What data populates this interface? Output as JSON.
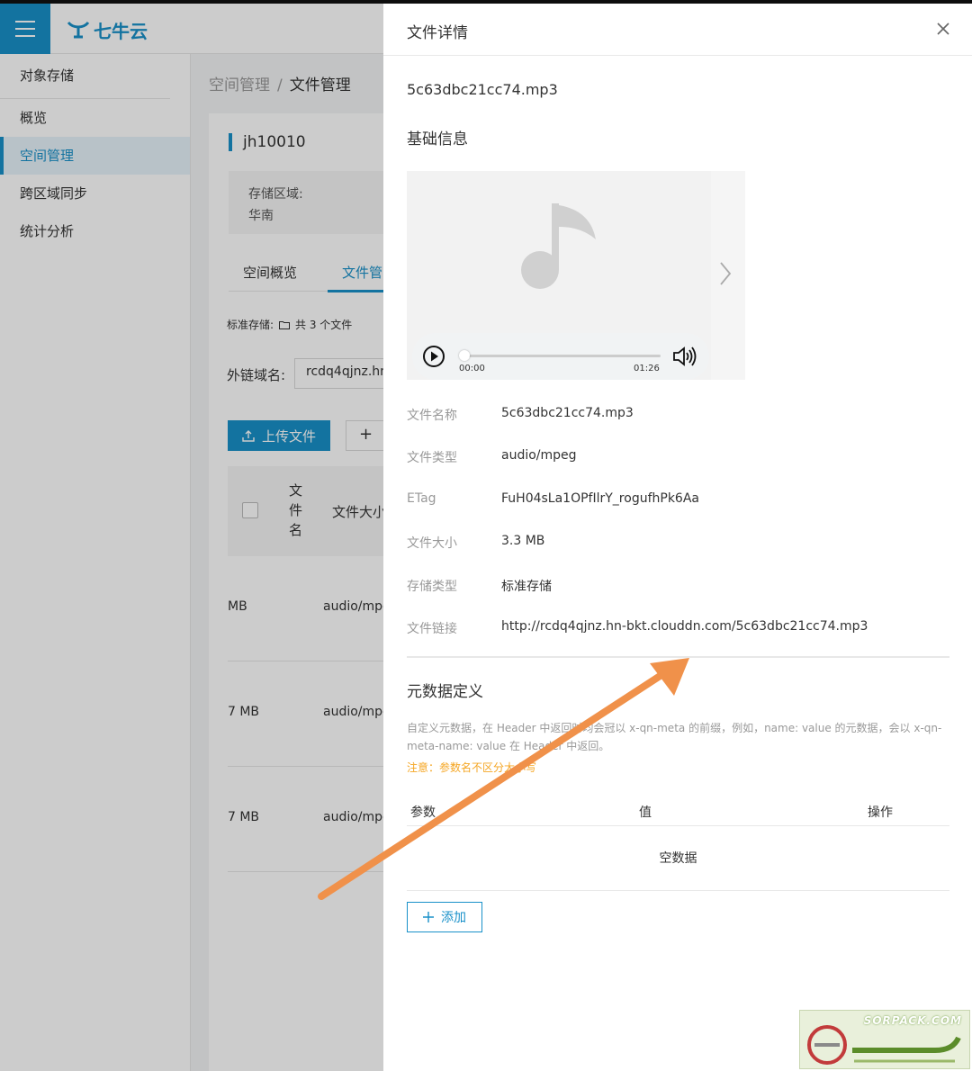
{
  "app": {
    "logo_text": "七牛云"
  },
  "sidebar": {
    "title": "对象存储",
    "items": [
      {
        "label": "概览"
      },
      {
        "label": "空间管理"
      },
      {
        "label": "跨区域同步"
      },
      {
        "label": "统计分析"
      }
    ]
  },
  "breadcrumb": {
    "parent": "空间管理",
    "separator": "/",
    "current": "文件管理"
  },
  "bucket": {
    "name": "jh10010",
    "region_label": "存储区域:",
    "region_value": "华南"
  },
  "tabs": [
    "空间概览",
    "文件管"
  ],
  "storage_line": {
    "label": "标准存储:",
    "count": "共 3 个文件"
  },
  "domain": {
    "label": "外链域名:",
    "value": "rcdq4qjnz.hn"
  },
  "toolbar": {
    "upload_label": "上传文件",
    "new_label": "+"
  },
  "file_table": {
    "col_name": "文件名",
    "col_size": "文件大小",
    "rows": [
      {
        "size": "MB",
        "type": "audio/mpe"
      },
      {
        "size": "7 MB",
        "type": "audio/mpe"
      },
      {
        "size": "7 MB",
        "type": "audio/mpe"
      }
    ]
  },
  "drawer": {
    "title": "文件详情",
    "file_name": "5c63dbc21cc74.mp3",
    "basic_section": "基础信息",
    "player": {
      "current_time": "00:00",
      "duration": "01:26",
      "progress": 0
    },
    "info": [
      {
        "label": "文件名称",
        "value": "5c63dbc21cc74.mp3"
      },
      {
        "label": "文件类型",
        "value": "audio/mpeg"
      },
      {
        "label": "ETag",
        "value": "FuH04sLa1OPfIlrY_rogufhPk6Aa"
      },
      {
        "label": "文件大小",
        "value": "3.3 MB"
      },
      {
        "label": "存储类型",
        "value": "标准存储"
      },
      {
        "label": "文件链接",
        "value": "http://rcdq4qjnz.hn-bkt.clouddn.com/5c63dbc21cc74.mp3"
      }
    ],
    "meta_section": "元数据定义",
    "meta_desc": "自定义元数据，在 Header 中返回时均会冠以 x-qn-meta 的前缀，例如，name: value 的元数据，会以 x-qn-meta-name: value 在 Header 中返回。",
    "meta_note": "注意：参数名不区分大小写",
    "meta_table": {
      "col_param": "参数",
      "col_value": "值",
      "col_action": "操作",
      "empty": "空数据"
    },
    "add_label": "添加"
  },
  "watermark": {
    "text": "SORPACK.COM"
  },
  "colors": {
    "accent": "#1890c9",
    "arrow": "#f0914a",
    "warning": "#f5a623"
  }
}
